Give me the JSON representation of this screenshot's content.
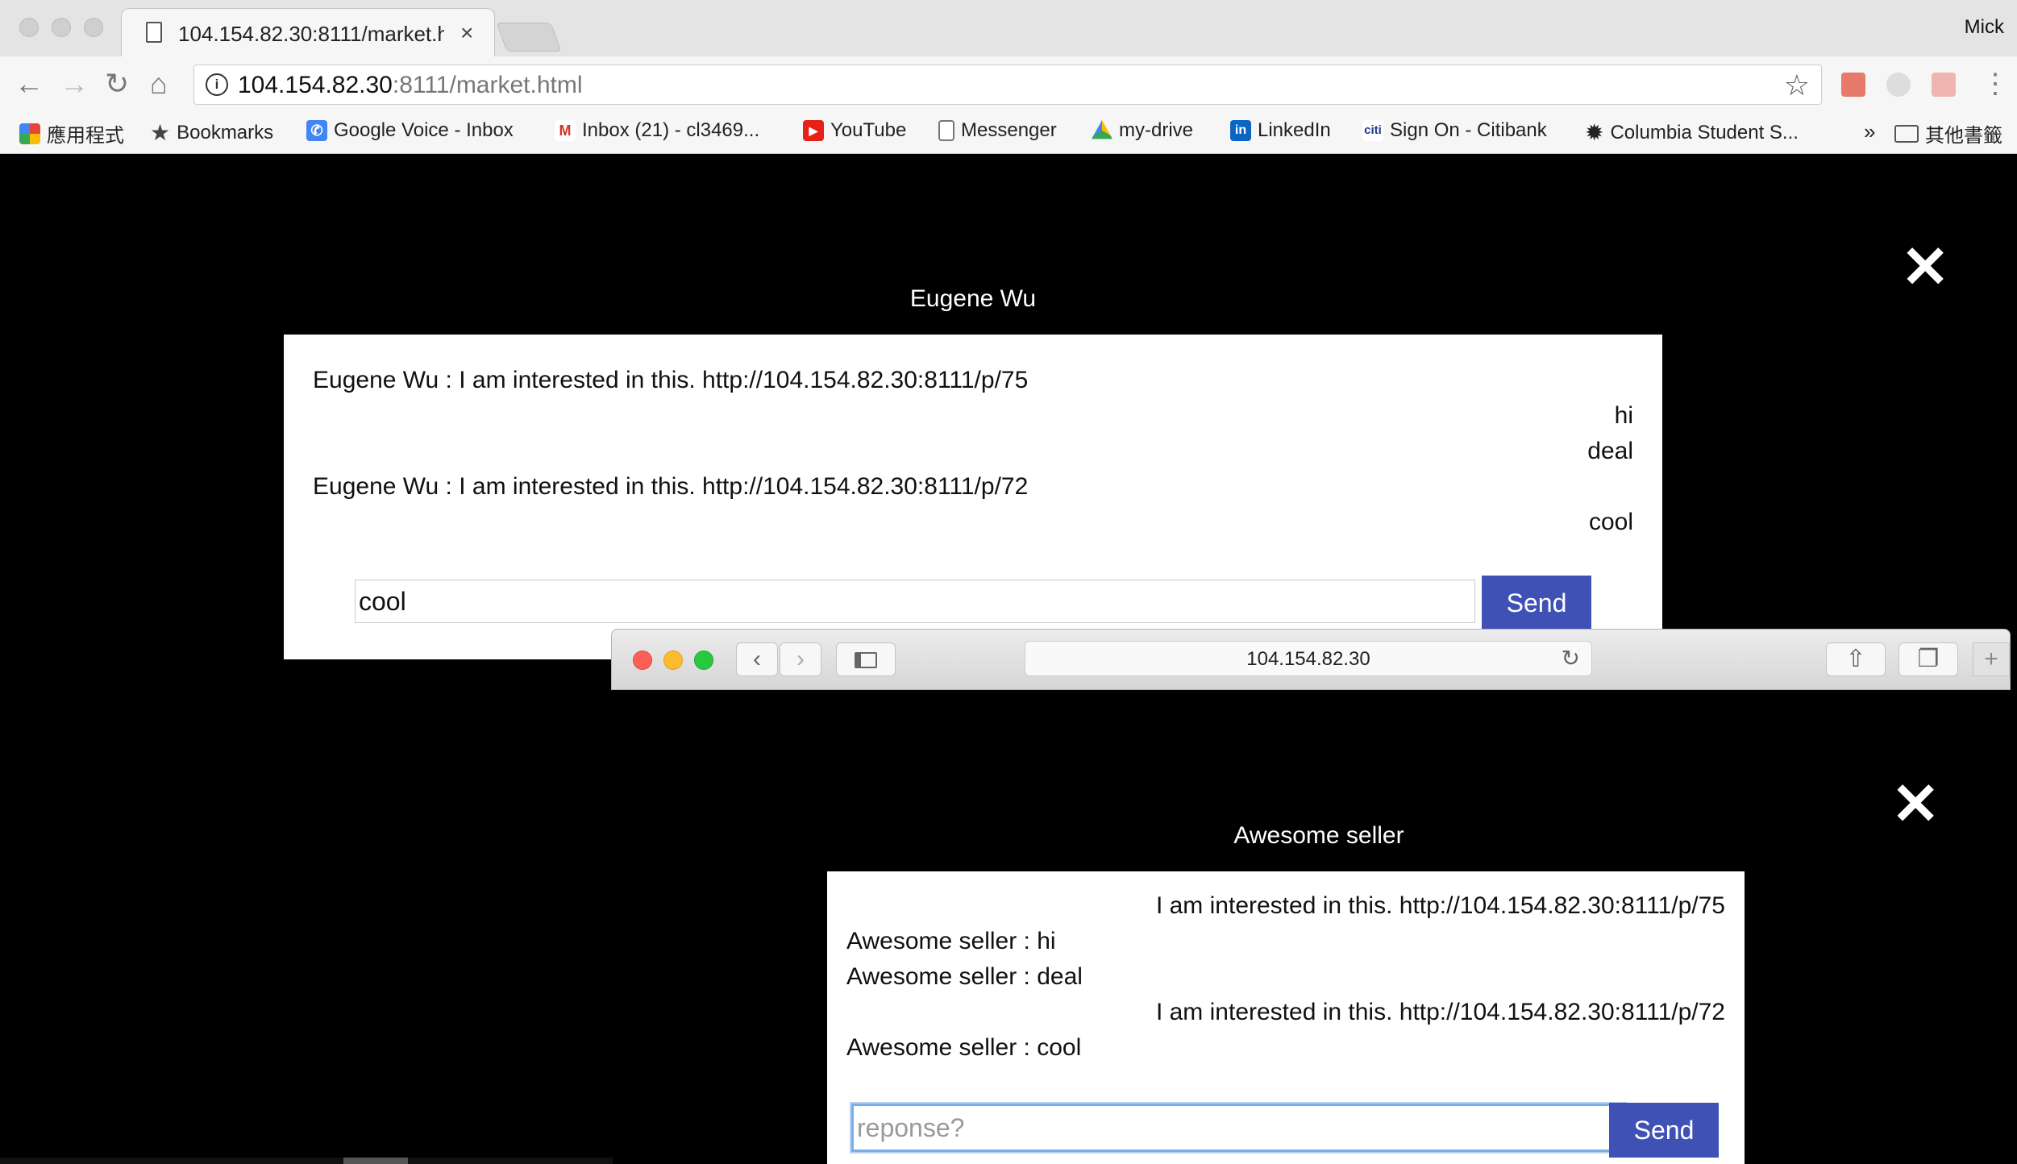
{
  "chrome": {
    "tab_title": "104.154.82.30:8111/market.html",
    "tab_close": "×",
    "profile_name": "Mick",
    "url_host": "104.154.82.30",
    "url_rest": ":8111/market.html"
  },
  "bookmarks": [
    {
      "label": "應用程式",
      "icon": "apps-grid-icon"
    },
    {
      "label": "Bookmarks",
      "icon": "star-icon"
    },
    {
      "label": "Google Voice - Inbox",
      "icon": "google-voice-icon"
    },
    {
      "label": "Inbox (21) - cl3469...",
      "icon": "gmail-icon"
    },
    {
      "label": "YouTube",
      "icon": "youtube-icon"
    },
    {
      "label": "Messenger",
      "icon": "page-icon"
    },
    {
      "label": "my-drive",
      "icon": "google-drive-icon"
    },
    {
      "label": "LinkedIn",
      "icon": "linkedin-icon"
    },
    {
      "label": "Sign On - Citibank",
      "icon": "citi-icon"
    },
    {
      "label": "Columbia Student S...",
      "icon": "columbia-icon"
    }
  ],
  "bookmarks_overflow": "»",
  "bookmarks_other": "其他書籤",
  "chat1": {
    "title": "Eugene Wu",
    "messages": [
      {
        "text": "Eugene Wu : I am interested in this. http://104.154.82.30:8111/p/75",
        "side": "left"
      },
      {
        "text": "hi",
        "side": "right"
      },
      {
        "text": "deal",
        "side": "right"
      },
      {
        "text": "Eugene Wu : I am interested in this. http://104.154.82.30:8111/p/72",
        "side": "left"
      },
      {
        "text": "cool",
        "side": "right"
      }
    ],
    "input_value": "cool",
    "send_label": "Send"
  },
  "safari": {
    "url": "104.154.82.30"
  },
  "chat2": {
    "title": "Awesome seller",
    "messages": [
      {
        "text": "I am interested in this. http://104.154.82.30:8111/p/75",
        "side": "right"
      },
      {
        "text": "Awesome seller : hi",
        "side": "left"
      },
      {
        "text": "Awesome seller : deal",
        "side": "left"
      },
      {
        "text": "I am interested in this. http://104.154.82.30:8111/p/72",
        "side": "right"
      },
      {
        "text": "Awesome seller : cool",
        "side": "left"
      }
    ],
    "input_placeholder": "reponse?",
    "send_label": "Send"
  },
  "colors": {
    "send_button": "#3f51b5",
    "page_background": "#000000"
  }
}
